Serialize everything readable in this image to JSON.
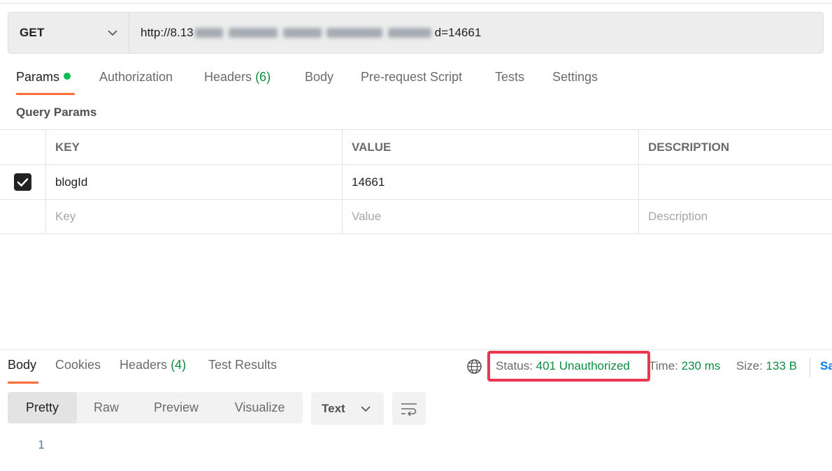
{
  "request": {
    "method": "GET",
    "url_prefix": "http://8.13",
    "url_suffix": "d=14661",
    "tabs": [
      {
        "label": "Params"
      },
      {
        "label": "Authorization"
      },
      {
        "label": "Headers",
        "count": "(6)"
      },
      {
        "label": "Body"
      },
      {
        "label": "Pre-request Script"
      },
      {
        "label": "Tests"
      },
      {
        "label": "Settings"
      }
    ],
    "query_params_title": "Query Params",
    "table": {
      "headers": [
        "KEY",
        "VALUE",
        "DESCRIPTION"
      ],
      "rows": [
        {
          "checked": true,
          "key": "blogId",
          "value": "14661",
          "description": ""
        }
      ],
      "placeholder": {
        "key": "Key",
        "value": "Value",
        "description": "Description"
      }
    }
  },
  "response": {
    "tabs": [
      {
        "label": "Body"
      },
      {
        "label": "Cookies"
      },
      {
        "label": "Headers",
        "count": "(4)"
      },
      {
        "label": "Test Results"
      }
    ],
    "status_label": "Status:",
    "status_value": "401 Unauthorized",
    "time_label": "Time:",
    "time_value": "230 ms",
    "size_label": "Size:",
    "size_value": "133 B",
    "save_link": "Sa",
    "view_modes": [
      "Pretty",
      "Raw",
      "Preview",
      "Visualize"
    ],
    "format": "Text",
    "line_number": "1"
  },
  "colors": {
    "accent": "#ff6c37",
    "success": "#0b8d42",
    "highlight_box": "#e8384f",
    "link": "#097bed"
  }
}
